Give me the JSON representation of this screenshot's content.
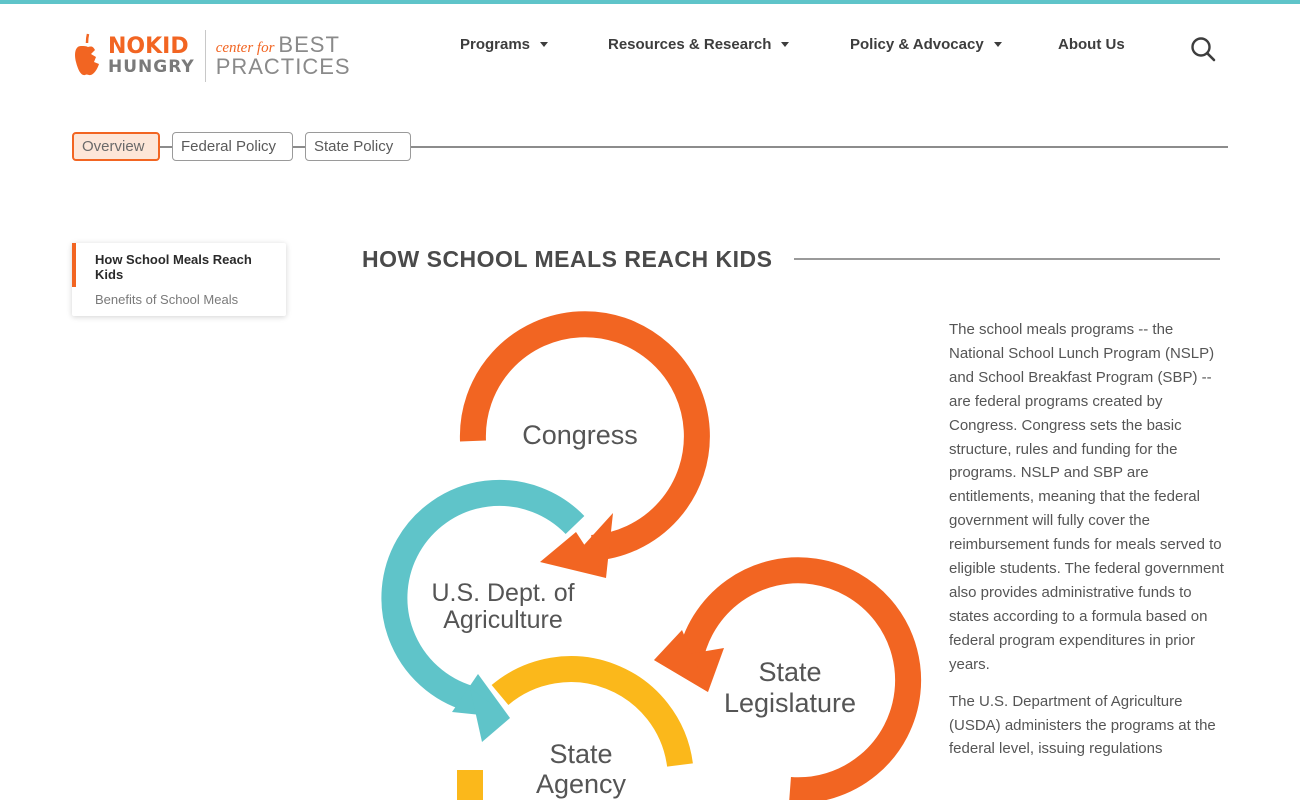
{
  "brand": {
    "logo_line1_no": "NO",
    "logo_line1_kid": "KID",
    "logo_line2": "HUNGRY",
    "center_for": "center for",
    "best": "BEST",
    "practices": "PRACTICES",
    "orange": "#f26522",
    "teal": "#5fc4c9",
    "yellow": "#fbb81b"
  },
  "nav": {
    "items": [
      {
        "label": "Programs",
        "has_dropdown": true
      },
      {
        "label": "Resources & Research",
        "has_dropdown": true
      },
      {
        "label": "Policy & Advocacy",
        "has_dropdown": true
      },
      {
        "label": "About Us",
        "has_dropdown": false
      }
    ],
    "search_icon": "search-icon"
  },
  "tabs": [
    {
      "label": "Overview",
      "active": true
    },
    {
      "label": "Federal Policy",
      "active": false
    },
    {
      "label": "State Policy",
      "active": false
    }
  ],
  "sidenav": {
    "items": [
      {
        "label": "How School Meals Reach Kids",
        "active": true
      },
      {
        "label": "Benefits of School Meals",
        "active": false
      }
    ]
  },
  "section": {
    "title": "HOW SCHOOL MEALS REACH KIDS"
  },
  "diagram": {
    "nodes": [
      {
        "label_lines": [
          "Congress"
        ],
        "color": "#f26522"
      },
      {
        "label_lines": [
          "U.S. Dept. of",
          "Agriculture"
        ],
        "color": "#5fc4c9"
      },
      {
        "label_lines": [
          "State",
          "Legislature"
        ],
        "color": "#f26522"
      },
      {
        "label_lines": [
          "State",
          "Agency"
        ],
        "color": "#fbb81b"
      }
    ]
  },
  "body": {
    "paragraphs": [
      "The school meals programs -- the National School Lunch Program (NSLP) and School Breakfast Program (SBP) -- are federal programs created by Congress. Congress sets the basic structure, rules and funding for the programs. NSLP and SBP are entitlements, meaning that the federal government will fully cover the reimbursement funds for meals served to eligible students. The federal government also provides administrative funds to states according to a formula based on federal program expenditures in prior years.",
      "The U.S. Department of Agriculture (USDA) administers the programs at the federal level, issuing regulations"
    ]
  }
}
